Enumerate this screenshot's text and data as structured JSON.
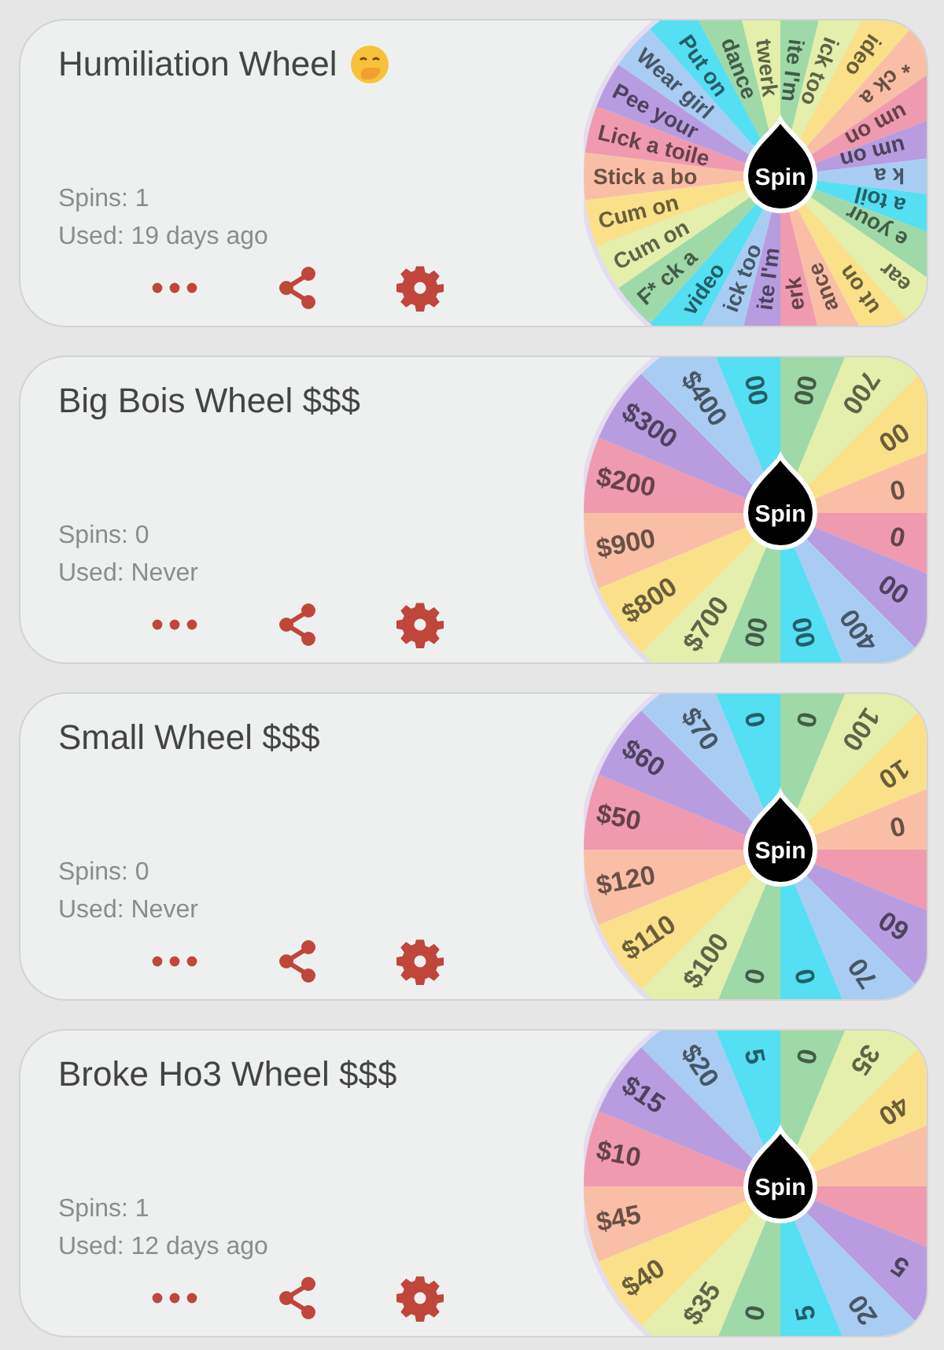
{
  "wheels": [
    {
      "title": "Humiliation Wheel",
      "emoji": true,
      "spins": "Spins: 1",
      "used": "Used: 19 days ago",
      "spin_button": "Spin",
      "segments": [
        {
          "label": "ite I'm",
          "color": "#9fd9a8"
        },
        {
          "label": "ick too",
          "color": "#e3efab"
        },
        {
          "label": "ideo",
          "color": "#fbe08a"
        },
        {
          "label": "* ck a",
          "color": "#f9bfa6"
        },
        {
          "label": "um on",
          "color": "#f09aaf"
        },
        {
          "label": "um on",
          "color": "#b79de0"
        },
        {
          "label": "k a",
          "color": "#a9cdf2"
        },
        {
          "label": "a toil",
          "color": "#55dff2"
        },
        {
          "label": "e your",
          "color": "#9fd9a8"
        },
        {
          "label": "ear",
          "color": "#e3efab"
        },
        {
          "label": "ut on",
          "color": "#fbe08a"
        },
        {
          "label": "ance",
          "color": "#f9bfa6"
        },
        {
          "label": "erk",
          "color": "#f09aaf"
        },
        {
          "label": "ite I'm",
          "color": "#b79de0"
        },
        {
          "label": "ick too",
          "color": "#a9cdf2"
        },
        {
          "label": "video",
          "color": "#55dff2"
        },
        {
          "label": "F* ck a",
          "color": "#9fd9a8"
        },
        {
          "label": "Cum on",
          "color": "#e3efab"
        },
        {
          "label": "Cum on",
          "color": "#fbe08a"
        },
        {
          "label": "Stick a bo",
          "color": "#f9bfa6"
        },
        {
          "label": "Lick a toile",
          "color": "#f09aaf"
        },
        {
          "label": "Pee your",
          "color": "#b79de0"
        },
        {
          "label": "Wear girl",
          "color": "#a9cdf2"
        },
        {
          "label": "Put on",
          "color": "#55dff2"
        },
        {
          "label": "dance",
          "color": "#9fd9a8"
        },
        {
          "label": "twerk",
          "color": "#e3efab"
        }
      ]
    },
    {
      "title": "Big Bois Wheel $$$",
      "spins": "Spins: 0",
      "used": "Used: Never",
      "spin_button": "Spin",
      "segments": [
        {
          "label": "00",
          "color": "#9fd9a8"
        },
        {
          "label": "700",
          "color": "#e3efab"
        },
        {
          "label": "00",
          "color": "#fbe08a"
        },
        {
          "label": "0",
          "color": "#f9bfa6"
        },
        {
          "label": "0",
          "color": "#f09aaf"
        },
        {
          "label": "00",
          "color": "#b79de0"
        },
        {
          "label": "400",
          "color": "#a9cdf2"
        },
        {
          "label": "00",
          "color": "#55dff2"
        },
        {
          "label": "00",
          "color": "#9fd9a8"
        },
        {
          "label": "$700",
          "color": "#e3efab"
        },
        {
          "label": "$800",
          "color": "#fbe08a"
        },
        {
          "label": "$900",
          "color": "#f9bfa6"
        },
        {
          "label": "$200",
          "color": "#f09aaf"
        },
        {
          "label": "$300",
          "color": "#b79de0"
        },
        {
          "label": "$400",
          "color": "#a9cdf2"
        },
        {
          "label": "00",
          "color": "#55dff2"
        }
      ]
    },
    {
      "title": "Small Wheel $$$",
      "spins": "Spins: 0",
      "used": "Used: Never",
      "spin_button": "Spin",
      "segments": [
        {
          "label": "0",
          "color": "#9fd9a8"
        },
        {
          "label": "100",
          "color": "#e3efab"
        },
        {
          "label": "10",
          "color": "#fbe08a"
        },
        {
          "label": "0",
          "color": "#f9bfa6"
        },
        {
          "color": "#f09aaf"
        },
        {
          "label": "60",
          "color": "#b79de0"
        },
        {
          "label": "70",
          "color": "#a9cdf2"
        },
        {
          "label": "0",
          "color": "#55dff2"
        },
        {
          "label": "0",
          "color": "#9fd9a8"
        },
        {
          "label": "$100",
          "color": "#e3efab"
        },
        {
          "label": "$110",
          "color": "#fbe08a"
        },
        {
          "label": "$120",
          "color": "#f9bfa6"
        },
        {
          "label": "$50",
          "color": "#f09aaf"
        },
        {
          "label": "$60",
          "color": "#b79de0"
        },
        {
          "label": "$70",
          "color": "#a9cdf2"
        },
        {
          "label": "0",
          "color": "#55dff2"
        }
      ]
    },
    {
      "title": "Broke Ho3 Wheel $$$",
      "spins": "Spins: 1",
      "used": "Used: 12 days ago",
      "spin_button": "Spin",
      "segments": [
        {
          "label": "0",
          "color": "#9fd9a8"
        },
        {
          "label": "35",
          "color": "#e3efab"
        },
        {
          "label": "40",
          "color": "#fbe08a"
        },
        {
          "color": "#f9bfa6"
        },
        {
          "color": "#f09aaf"
        },
        {
          "label": "5",
          "color": "#b79de0"
        },
        {
          "label": "20",
          "color": "#a9cdf2"
        },
        {
          "label": "5",
          "color": "#55dff2"
        },
        {
          "label": "0",
          "color": "#9fd9a8"
        },
        {
          "label": "$35",
          "color": "#e3efab"
        },
        {
          "label": "$40",
          "color": "#fbe08a"
        },
        {
          "label": "$45",
          "color": "#f9bfa6"
        },
        {
          "label": "$10",
          "color": "#f09aaf"
        },
        {
          "label": "$15",
          "color": "#b79de0"
        },
        {
          "label": "$20",
          "color": "#a9cdf2"
        },
        {
          "label": "5",
          "color": "#55dff2"
        }
      ]
    }
  ]
}
